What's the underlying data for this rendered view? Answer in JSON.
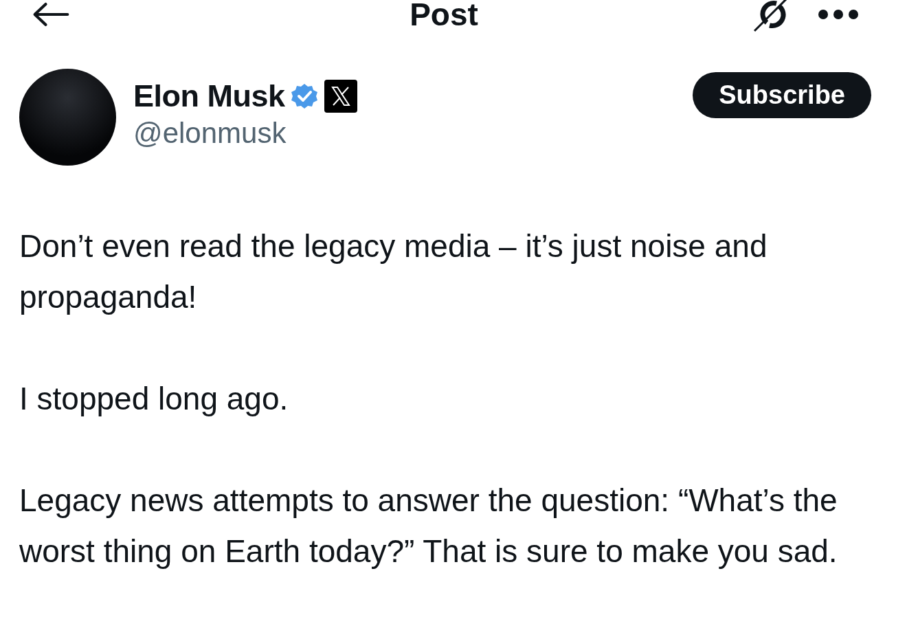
{
  "header": {
    "title": "Post"
  },
  "author": {
    "name": "Elon Musk",
    "handle": "@elonmusk",
    "verified": true,
    "affiliate_badge": true
  },
  "subscribe_button": {
    "label": "Subscribe"
  },
  "post": {
    "paragraphs": [
      "Don’t even read the legacy media – it’s just noise and propaganda!",
      "I stopped long ago.",
      "Legacy news attempts to answer the question: “What’s the worst thing on Earth today?” That is sure to make you sad."
    ]
  }
}
